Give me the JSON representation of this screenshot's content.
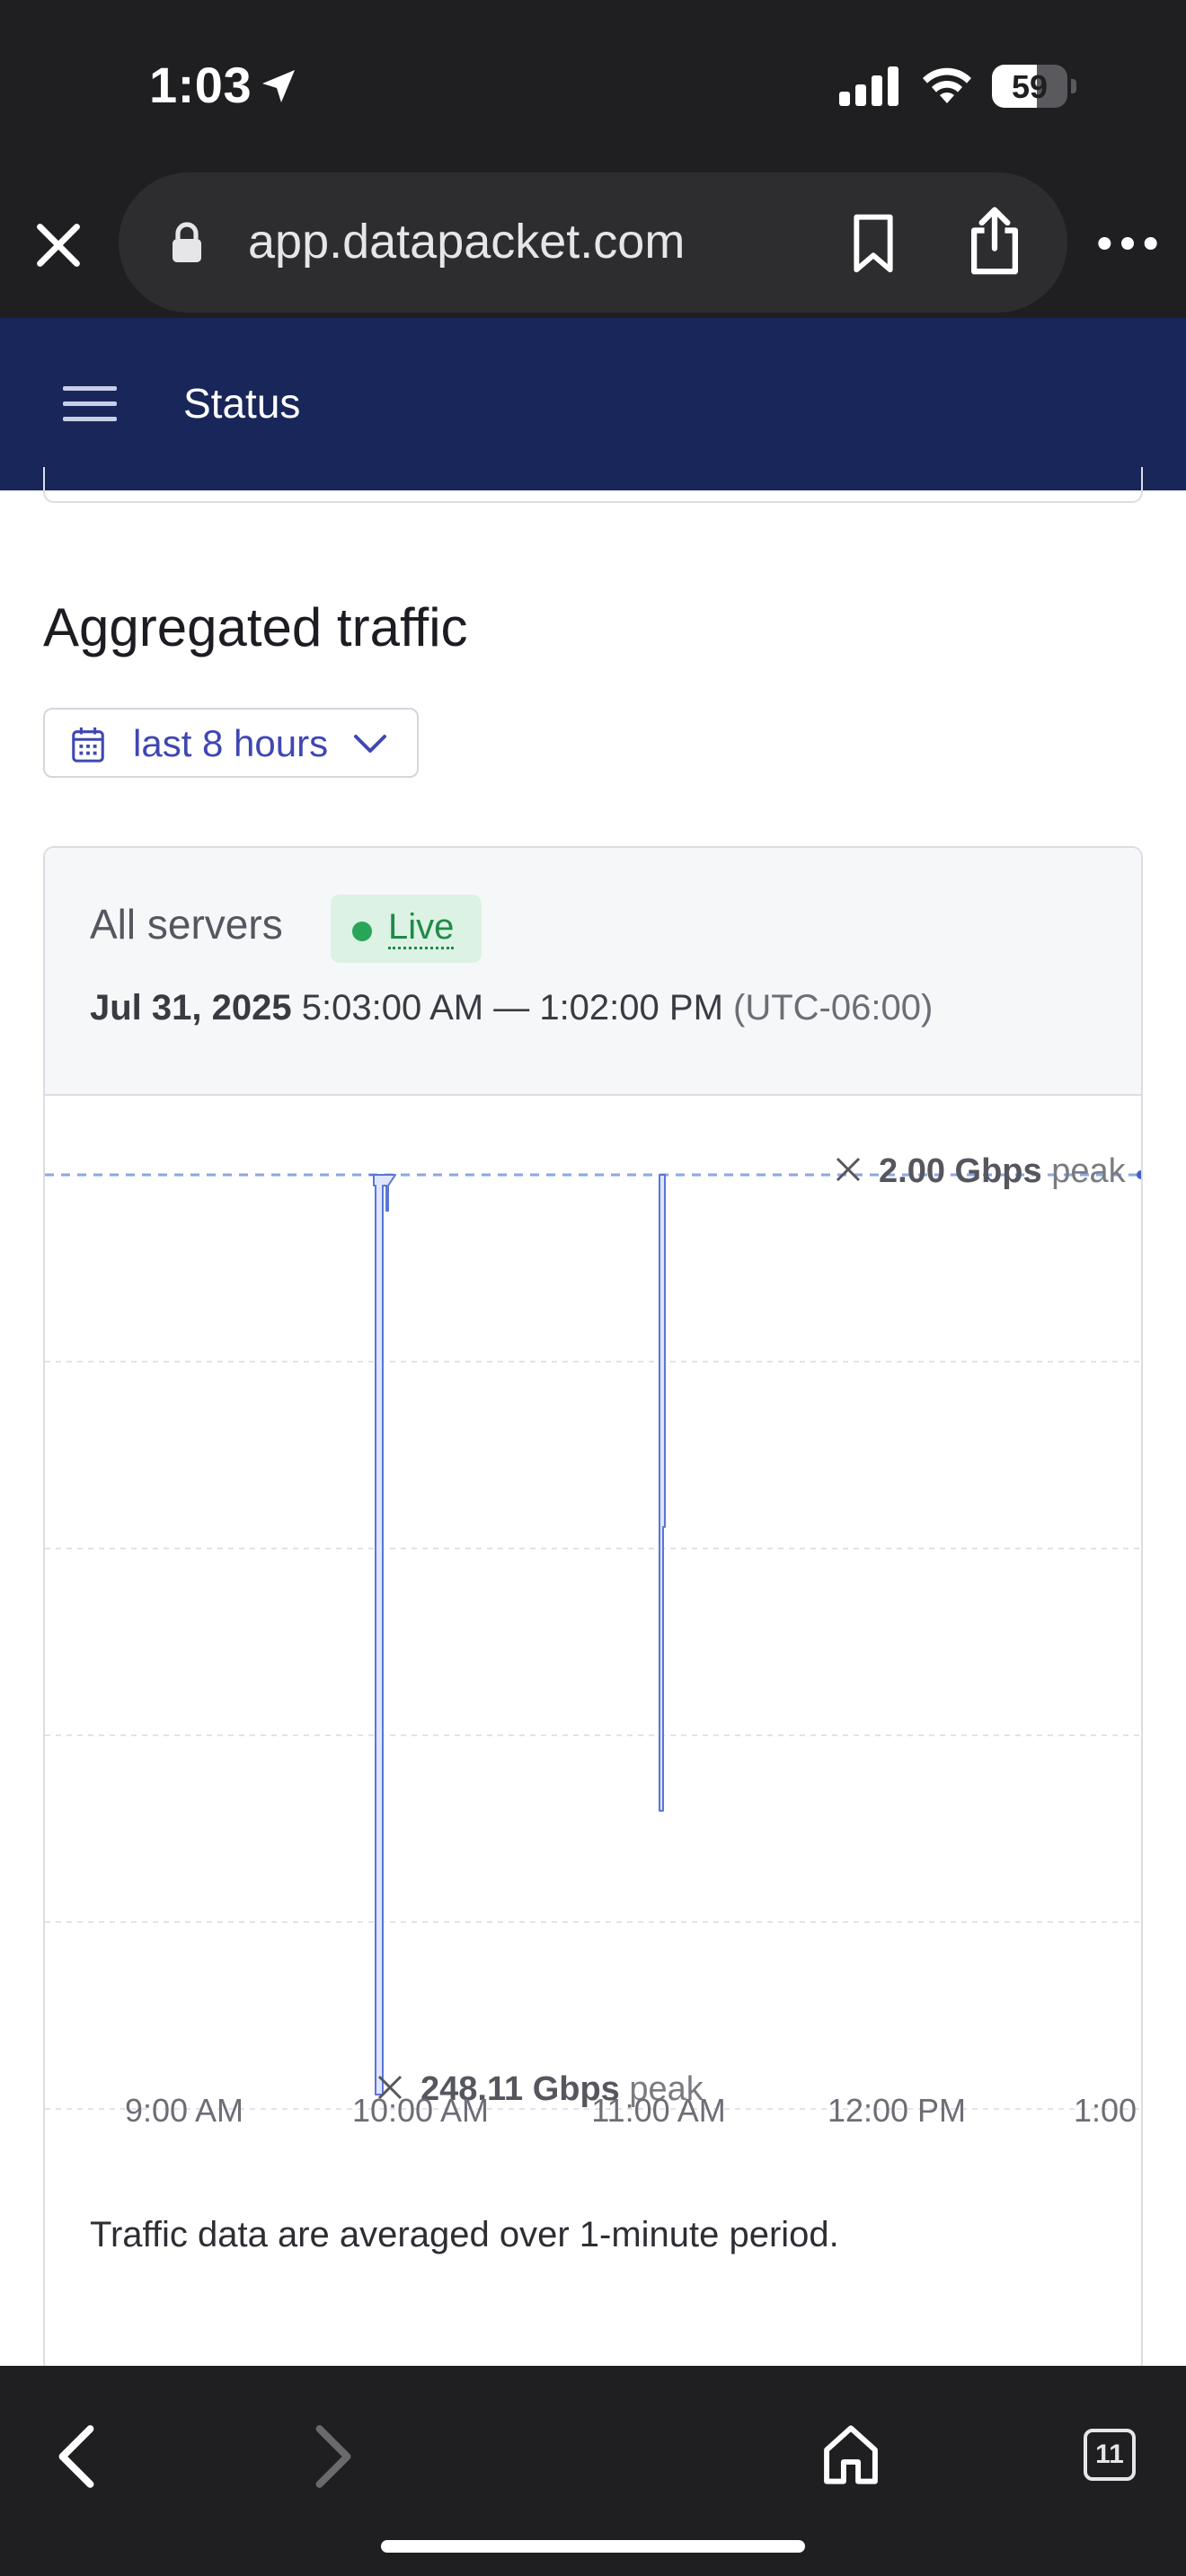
{
  "status_bar": {
    "time": "1:03",
    "battery": "59",
    "battery_level": 0.59
  },
  "browser": {
    "url": "app.datapacket.com"
  },
  "header": {
    "title": "Status"
  },
  "section": {
    "title": "Aggregated traffic",
    "range_label": "last 8 hours"
  },
  "card": {
    "title": "All servers",
    "live_label": "Live",
    "range_date": "Jul 31, 2025",
    "range_times": "5:03:00 AM — 1:02:00 PM",
    "range_tz": "(UTC-06:00)",
    "footnote": "Traffic data are averaged over 1-minute period."
  },
  "chart_data": {
    "type": "line",
    "x_ticks": [
      "9:00 AM",
      "10:00 AM",
      "11:00 AM",
      "12:00 PM",
      "1:00"
    ],
    "annotations": {
      "top_value": "2.00 Gbps",
      "top_suffix": "peak",
      "bottom_value": "248.11 Gbps",
      "bottom_suffix": "peak"
    },
    "grid": true,
    "colors": {
      "line": "#5b76d6",
      "fill": "#dfe5fa",
      "baseline": "#8aa6e6"
    }
  },
  "toolbar": {
    "tabs_count": "11"
  }
}
